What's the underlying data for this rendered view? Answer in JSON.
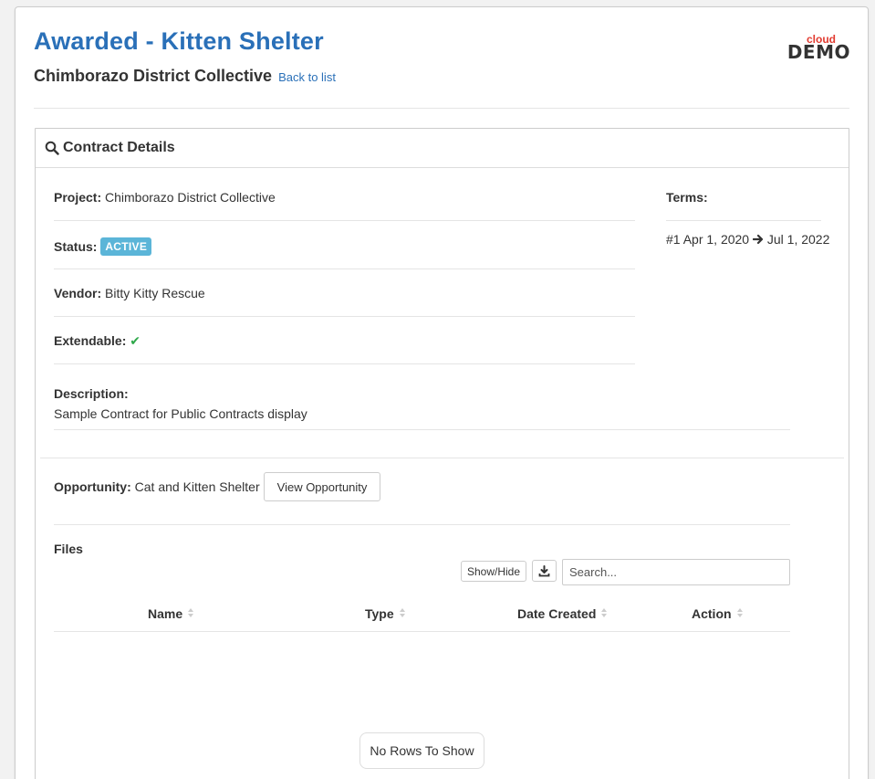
{
  "header": {
    "title": "Awarded - Kitten Shelter",
    "subtitle": "Chimborazo District Collective",
    "back_link": "Back to list",
    "logo_top": "cloud",
    "logo_bottom": "DEMO"
  },
  "panel": {
    "title": "Contract Details"
  },
  "details": {
    "project_label": "Project:",
    "project_value": "Chimborazo District Collective",
    "status_label": "Status:",
    "status_value": "ACTIVE",
    "vendor_label": "Vendor:",
    "vendor_value": "Bitty Kitty Rescue",
    "extendable_label": "Extendable:",
    "extendable_value": "✔",
    "description_label": "Description:",
    "description_value": "Sample Contract for Public Contracts display"
  },
  "terms": {
    "label": "Terms:",
    "items": [
      {
        "number": "#1",
        "start": "Apr 1, 2020",
        "end": "Jul 1, 2022"
      }
    ]
  },
  "opportunity": {
    "label": "Opportunity:",
    "value": "Cat and Kitten Shelter",
    "button": "View Opportunity"
  },
  "files": {
    "label": "Files",
    "show_hide_button": "Show/Hide",
    "download_icon": "download-icon",
    "search_placeholder": "Search...",
    "columns": [
      "Name",
      "Type",
      "Date Created",
      "Action"
    ],
    "rows": [],
    "empty_message": "No Rows To Show"
  },
  "colors": {
    "title_blue": "#2a70b8",
    "badge_blue": "#5bb5d8",
    "check_green": "#2ea84a",
    "logo_red": "#e23b30"
  }
}
